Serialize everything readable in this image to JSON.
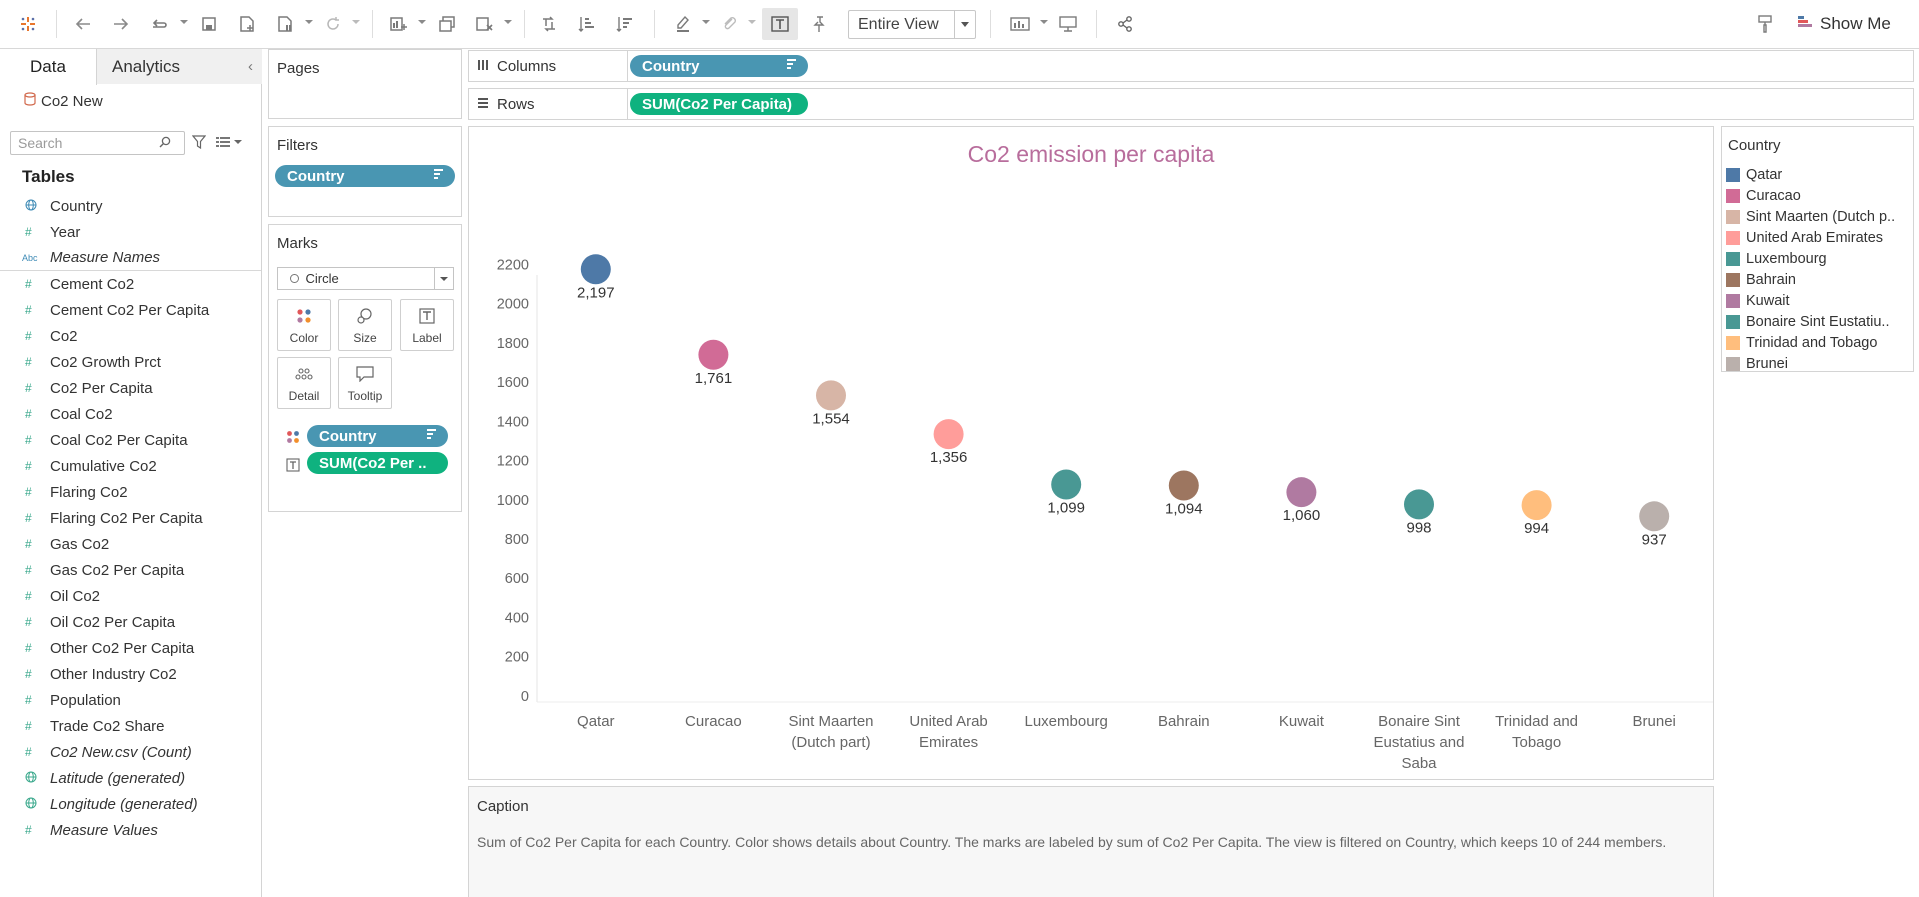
{
  "toolbar": {
    "fit_value": "Entire View",
    "show_me_label": "Show Me",
    "icons": [
      "tableau-logo-icon",
      "undo-icon",
      "redo-icon",
      "replay-icon",
      "save-icon",
      "new-data-source-icon",
      "pause-updates-icon",
      "refresh-icon",
      "new-worksheet-icon",
      "duplicate-sheet-icon",
      "clear-sheet-icon",
      "swap-rows-columns-icon",
      "sort-ascending-icon",
      "sort-descending-icon",
      "highlight-icon",
      "group-members-icon",
      "show-mark-labels-icon",
      "fix-axes-icon",
      "show-cards-icon",
      "presentation-mode-icon",
      "share-icon"
    ]
  },
  "data_pane": {
    "tabs": [
      "Data",
      "Analytics"
    ],
    "datasource": "Co2 New",
    "search_placeholder": "Search",
    "tables_label": "Tables",
    "fields": [
      {
        "name": "Country",
        "type": "geo",
        "italic": false
      },
      {
        "name": "Year",
        "type": "measure",
        "italic": false
      },
      {
        "name": "Measure Names",
        "type": "abc",
        "italic": true
      },
      {
        "name": "Cement Co2",
        "type": "measure",
        "italic": false
      },
      {
        "name": "Cement Co2 Per Capita",
        "type": "measure",
        "italic": false
      },
      {
        "name": "Co2",
        "type": "measure",
        "italic": false
      },
      {
        "name": "Co2 Growth Prct",
        "type": "measure",
        "italic": false
      },
      {
        "name": "Co2 Per Capita",
        "type": "measure",
        "italic": false
      },
      {
        "name": "Coal Co2",
        "type": "measure",
        "italic": false
      },
      {
        "name": "Coal Co2 Per Capita",
        "type": "measure",
        "italic": false
      },
      {
        "name": "Cumulative Co2",
        "type": "measure",
        "italic": false
      },
      {
        "name": "Flaring Co2",
        "type": "measure",
        "italic": false
      },
      {
        "name": "Flaring Co2 Per Capita",
        "type": "measure",
        "italic": false
      },
      {
        "name": "Gas Co2",
        "type": "measure",
        "italic": false
      },
      {
        "name": "Gas Co2 Per Capita",
        "type": "measure",
        "italic": false
      },
      {
        "name": "Oil Co2",
        "type": "measure",
        "italic": false
      },
      {
        "name": "Oil Co2 Per Capita",
        "type": "measure",
        "italic": false
      },
      {
        "name": "Other Co2 Per Capita",
        "type": "measure",
        "italic": false
      },
      {
        "name": "Other Industry Co2",
        "type": "measure",
        "italic": false
      },
      {
        "name": "Population",
        "type": "measure",
        "italic": false
      },
      {
        "name": "Trade Co2 Share",
        "type": "measure",
        "italic": false
      },
      {
        "name": "Co2 New.csv (Count)",
        "type": "measure",
        "italic": true
      },
      {
        "name": "Latitude (generated)",
        "type": "geo-measure",
        "italic": true
      },
      {
        "name": "Longitude (generated)",
        "type": "geo-measure",
        "italic": true
      },
      {
        "name": "Measure Values",
        "type": "measure",
        "italic": true
      }
    ]
  },
  "pages": {
    "title": "Pages"
  },
  "filters": {
    "title": "Filters",
    "pill": "Country"
  },
  "marks": {
    "title": "Marks",
    "type": "Circle",
    "buttons": [
      "Color",
      "Size",
      "Label",
      "Detail",
      "Tooltip"
    ],
    "pills": [
      "Country",
      "SUM(Co2 Per .."
    ]
  },
  "shelves": {
    "columns_label": "Columns",
    "columns_pill": "Country",
    "rows_label": "Rows",
    "rows_pill": "SUM(Co2 Per Capita)"
  },
  "chart_data": {
    "type": "scatter",
    "title": "Co2 emission per capita",
    "xlabel": "",
    "ylabel": "",
    "ylim": [
      0,
      2300
    ],
    "y_ticks": [
      0,
      200,
      400,
      600,
      800,
      1000,
      1200,
      1400,
      1600,
      1800,
      2000,
      2200
    ],
    "grid": false,
    "categories": [
      [
        "Qatar"
      ],
      [
        "Curacao"
      ],
      [
        "Sint Maarten",
        "(Dutch part)"
      ],
      [
        "United Arab",
        "Emirates"
      ],
      [
        "Luxembourg"
      ],
      [
        "Bahrain"
      ],
      [
        "Kuwait"
      ],
      [
        "Bonaire Sint",
        "Eustatius and",
        "Saba"
      ],
      [
        "Trinidad and",
        "Tobago"
      ],
      [
        "Brunei"
      ]
    ],
    "values": [
      2197,
      1761,
      1554,
      1356,
      1099,
      1094,
      1060,
      998,
      994,
      937
    ],
    "labels": [
      "2,197",
      "1,761",
      "1,554",
      "1,356",
      "1,099",
      "1,094",
      "1,060",
      "998",
      "994",
      "937"
    ],
    "colors": [
      "#4e79a7",
      "#d16b96",
      "#d7b5a6",
      "#ff9d9a",
      "#499894",
      "#9d7660",
      "#b07aa1",
      "#499894",
      "#ffbe7d",
      "#bab0ac"
    ]
  },
  "legend": {
    "title": "Country",
    "items": [
      {
        "label": "Qatar",
        "color": "#4e79a7"
      },
      {
        "label": "Curacao",
        "color": "#d16b96"
      },
      {
        "label": "Sint Maarten (Dutch p..",
        "color": "#d7b5a6"
      },
      {
        "label": "United Arab Emirates",
        "color": "#ff9d9a"
      },
      {
        "label": "Luxembourg",
        "color": "#499894"
      },
      {
        "label": "Bahrain",
        "color": "#9d7660"
      },
      {
        "label": "Kuwait",
        "color": "#b07aa1"
      },
      {
        "label": "Bonaire Sint Eustatiu..",
        "color": "#499894"
      },
      {
        "label": "Trinidad and Tobago",
        "color": "#ffbe7d"
      },
      {
        "label": "Brunei",
        "color": "#bab0ac"
      }
    ]
  },
  "caption": {
    "title": "Caption",
    "text": "Sum of Co2 Per Capita for each Country.  Color shows details about Country.  The marks are labeled by sum of Co2 Per Capita. The view is filtered on Country, which keeps 10 of 244 members."
  }
}
